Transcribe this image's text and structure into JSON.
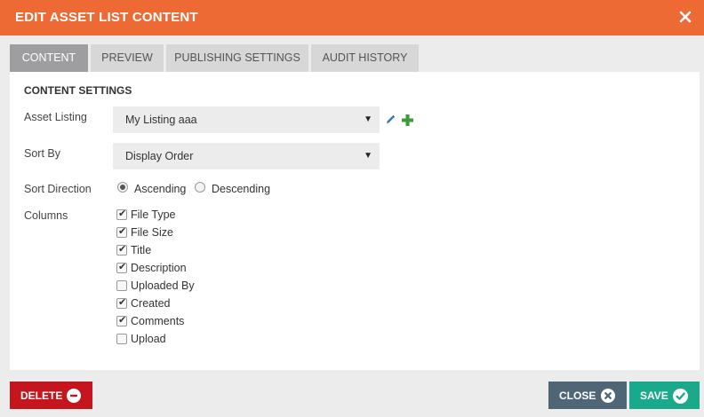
{
  "dialog": {
    "title": "EDIT ASSET LIST CONTENT",
    "accent_color": "#ee6a35"
  },
  "tabs": [
    {
      "label": "CONTENT",
      "active": true
    },
    {
      "label": "PREVIEW",
      "active": false
    },
    {
      "label": "PUBLISHING SETTINGS",
      "active": false
    },
    {
      "label": "AUDIT HISTORY",
      "active": false
    }
  ],
  "content": {
    "section_title": "CONTENT SETTINGS",
    "asset_listing": {
      "label": "Asset Listing",
      "value": "My Listing aaa"
    },
    "sort_by": {
      "label": "Sort By",
      "value": "Display Order"
    },
    "sort_direction": {
      "label": "Sort Direction",
      "options": [
        {
          "label": "Ascending",
          "checked": true
        },
        {
          "label": "Descending",
          "checked": false
        }
      ]
    },
    "columns": {
      "label": "Columns",
      "items": [
        {
          "label": "File Type",
          "checked": true
        },
        {
          "label": "File Size",
          "checked": true
        },
        {
          "label": "Title",
          "checked": true
        },
        {
          "label": "Description",
          "checked": true
        },
        {
          "label": "Uploaded By",
          "checked": false
        },
        {
          "label": "Created",
          "checked": true
        },
        {
          "label": "Comments",
          "checked": true
        },
        {
          "label": "Upload",
          "checked": false
        }
      ]
    }
  },
  "icons": {
    "close": "close-x-icon",
    "edit": "pencil-icon",
    "add": "plus-icon",
    "delete": "minus-circle-icon",
    "close_button": "x-circle-icon",
    "save": "check-circle-icon"
  },
  "footer": {
    "delete_label": "DELETE",
    "close_label": "CLOSE",
    "save_label": "SAVE",
    "colors": {
      "delete": "#c4161c",
      "close": "#4f6677",
      "save": "#1aa98a"
    }
  }
}
